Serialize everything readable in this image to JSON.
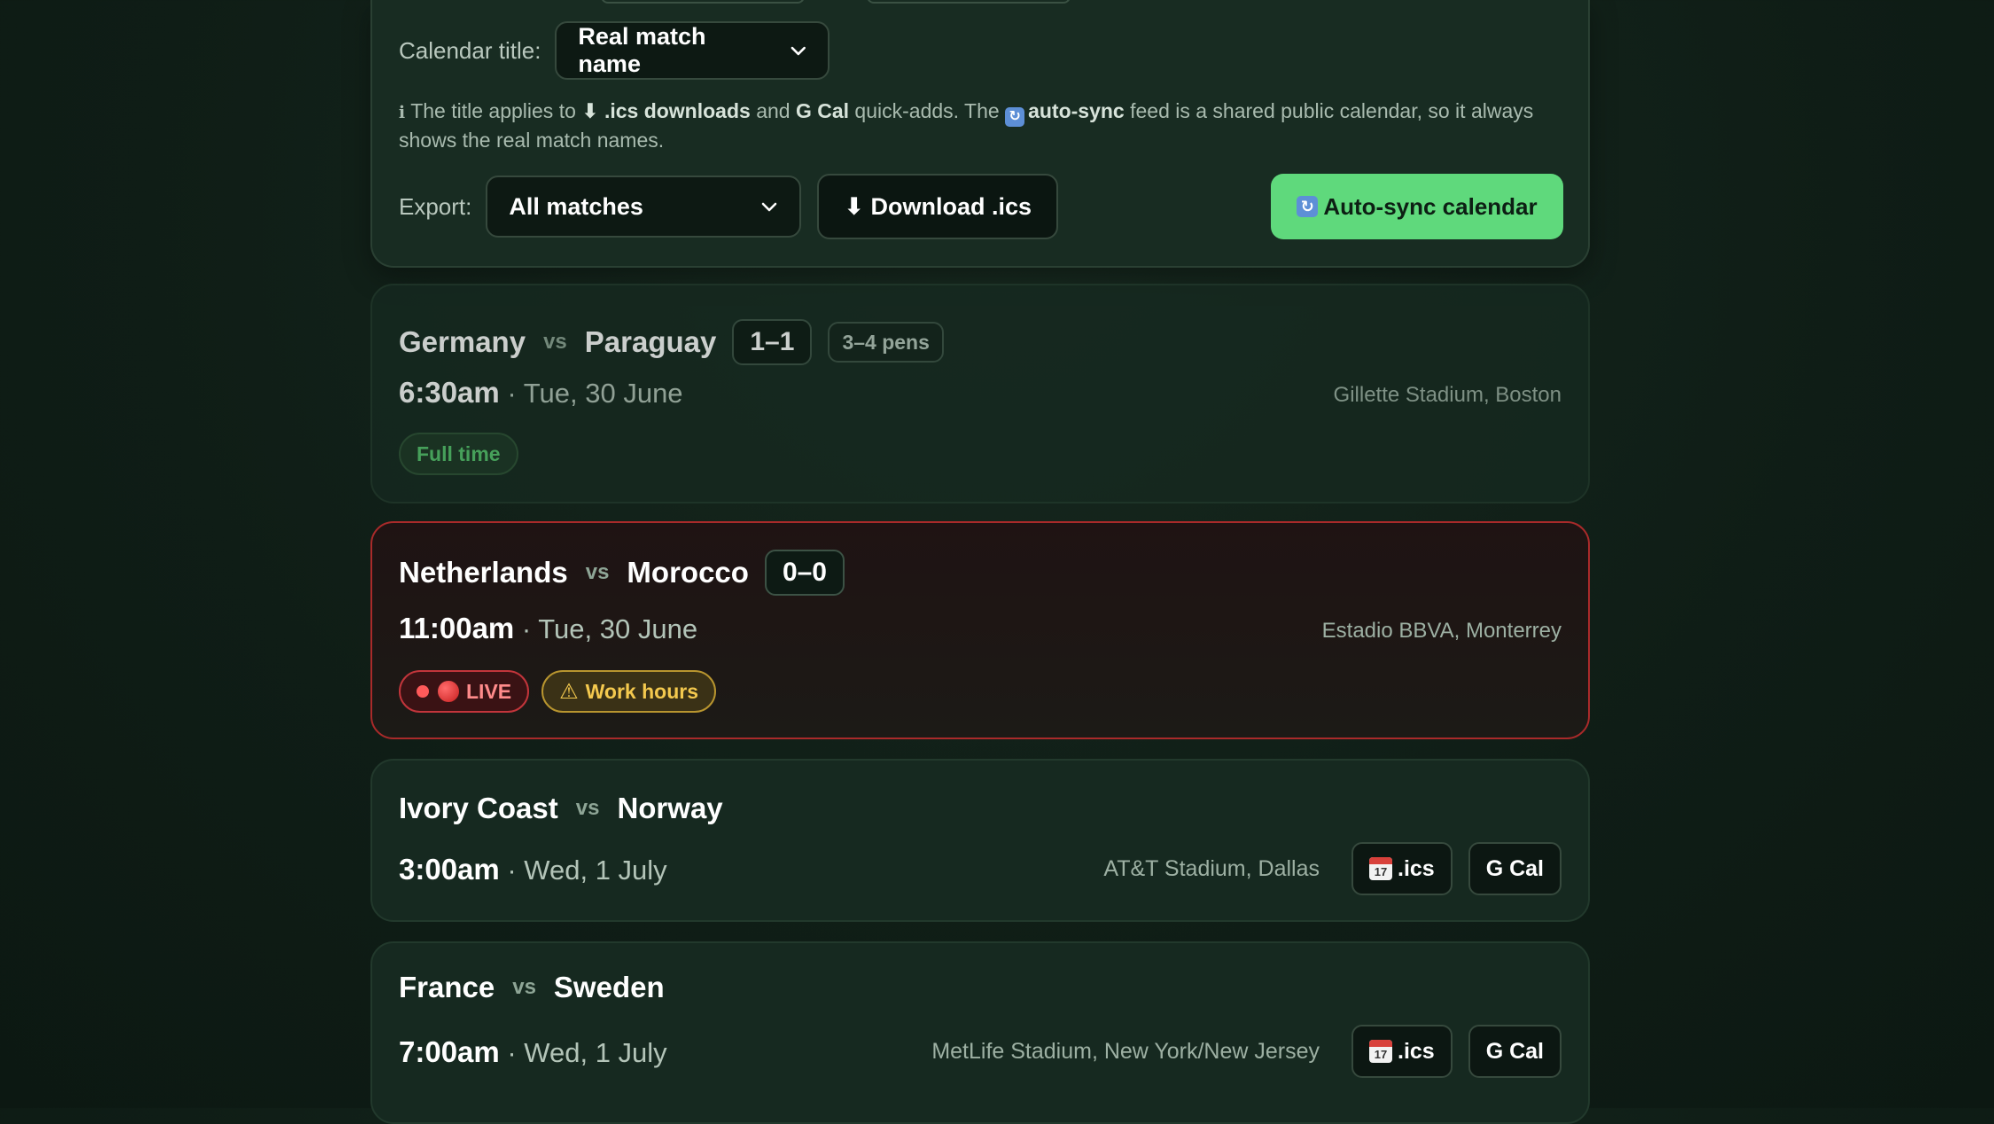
{
  "settings": {
    "calendar_title_label": "Calendar title:",
    "calendar_title_value": "Real match name",
    "note": {
      "info_icon": "ℹ",
      "p1": "The title applies to ",
      "ics_bold": "⬇ .ics downloads",
      "p2": " and ",
      "gcal_bold": "G Cal",
      "p3": " quick-adds. The ",
      "autosync_bold": "auto-sync",
      "p4": " feed is a shared public calendar, so it always shows the real match names."
    },
    "export_label": "Export:",
    "export_value": "All matches",
    "download_button": "⬇ Download .ics",
    "autosync_button": "Auto-sync calendar"
  },
  "matches": [
    {
      "home": "Germany",
      "vs": "vs",
      "away": "Paraguay",
      "score": "1–1",
      "pens": "3–4 pens",
      "time": "6:30am",
      "date": " · Tue, 30 June",
      "venue": "Gillette Stadium, Boston",
      "status": "Full time"
    },
    {
      "home": "Netherlands",
      "vs": "vs",
      "away": "Morocco",
      "score": "0–0",
      "time": "11:00am",
      "date": " · Tue, 30 June",
      "venue": "Estadio BBVA, Monterrey",
      "live_label": "LIVE",
      "work_label": "Work hours"
    },
    {
      "home": "Ivory Coast",
      "vs": "vs",
      "away": "Norway",
      "time": "3:00am",
      "date": " · Wed, 1 July",
      "venue": "AT&T Stadium, Dallas",
      "ics_label": ".ics",
      "gcal_label": "G Cal"
    },
    {
      "home": "France",
      "vs": "vs",
      "away": "Sweden",
      "time": "7:00am",
      "date": " · Wed, 1 July",
      "venue": "MetLife Stadium, New York/New Jersey",
      "ics_label": ".ics",
      "gcal_label": "G Cal"
    }
  ],
  "icons": {
    "calendar_day": "17",
    "chevron": "chevron-down-icon",
    "sync": "sync-icon",
    "warning": "⚠"
  },
  "colors": {
    "accent_green": "#5fd97c",
    "live_red": "#c2353b",
    "work_amber": "#f4c94e"
  }
}
